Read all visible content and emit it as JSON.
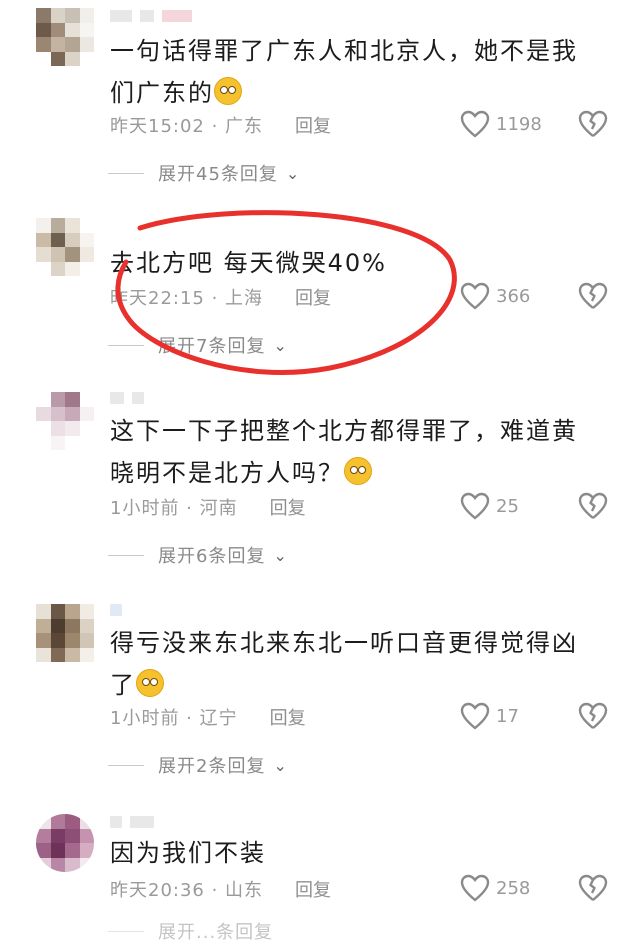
{
  "comments": [
    {
      "text": "一句话得罪了广东人和北京人，她不是我们广东的",
      "emoji": "flushed-emoji",
      "time_loc": "昨天15:02 · 广东",
      "reply": "回复",
      "likes": "1198",
      "expand": "展开45条回复"
    },
    {
      "text": "去北方吧 每天微哭40%",
      "time_loc": "昨天22:15 · 上海",
      "reply": "回复",
      "likes": "366",
      "expand": "展开7条回复"
    },
    {
      "text": "这下一下子把整个北方都得罪了，难道黄晓明不是北方人吗？",
      "emoji": "laughing-crying-emoji",
      "time_loc": "1小时前 · 河南",
      "reply": "回复",
      "likes": "25",
      "expand": "展开6条回复"
    },
    {
      "text": "得亏没来东北来东北一听口音更得觉得凶了",
      "emoji": "shocked-emoji",
      "time_loc": "1小时前 · 辽宁",
      "reply": "回复",
      "likes": "17",
      "expand": "展开2条回复"
    },
    {
      "text": "因为我们不装",
      "time_loc": "昨天20:36 · 山东",
      "reply": "回复",
      "likes": "258",
      "expand": "展开...条回复"
    }
  ],
  "colors": {
    "annotation_circle": "#e8302c",
    "meta_gray": "#9a9a9a"
  }
}
